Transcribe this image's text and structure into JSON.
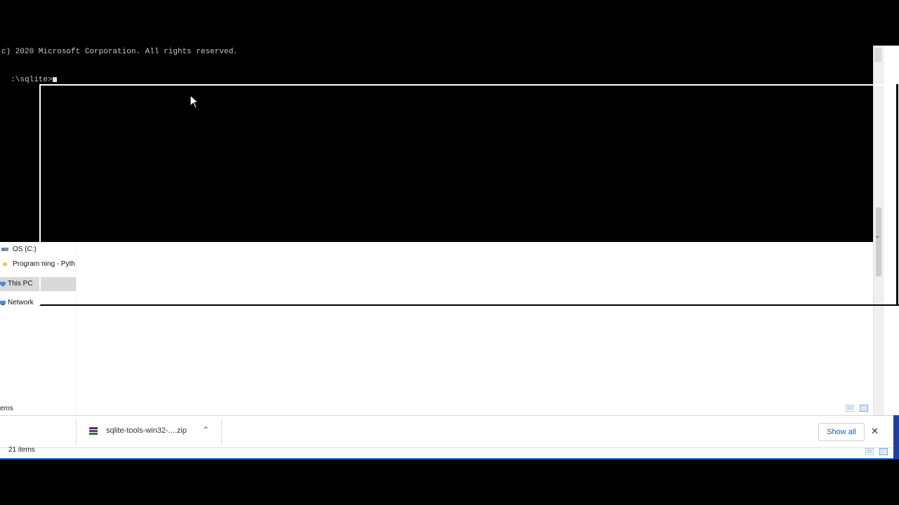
{
  "console": {
    "copyright_line": "c) 2020 Microsoft Corporation. All rights reserved.",
    "prompt_line": ":\\sqlite>"
  },
  "explorer": {
    "nav_items": [
      {
        "label": "OS (C:)",
        "icon": "drive-icon"
      },
      {
        "label": "Programming - Pyth",
        "icon": "folder-icon"
      },
      {
        "label": "This PC",
        "icon": "computer-icon"
      },
      {
        "label": "Network",
        "icon": "network-icon"
      }
    ],
    "status_fragment": "ems",
    "status_count": "21 items"
  },
  "downloads": {
    "file_name": "sqlite-tools-win32-....zip",
    "show_all_label": "Show all",
    "close_glyph": "✕",
    "chevron_glyph": "⌃"
  },
  "colors": {
    "console_bg": "#000000",
    "console_text": "#c8c8c8",
    "accent_blue": "#2b7bd0",
    "selected_nav_bg": "#d9d9d9"
  }
}
